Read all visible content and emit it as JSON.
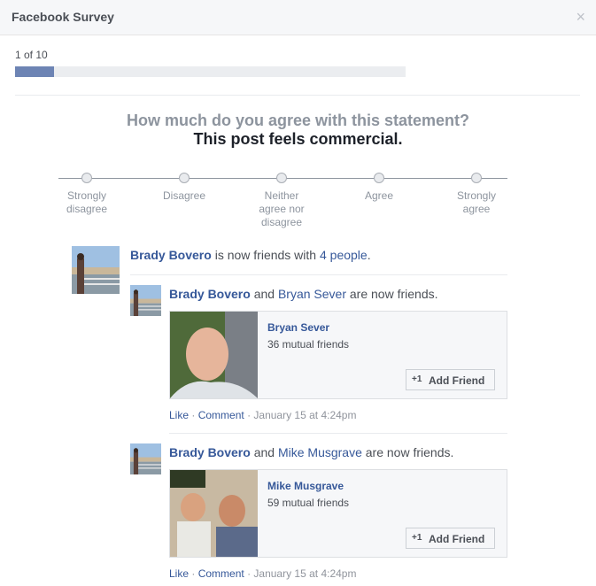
{
  "dialog": {
    "title": "Facebook Survey",
    "close_glyph": "×"
  },
  "progress": {
    "text": "1 of 10",
    "fraction": 0.1
  },
  "question": {
    "prompt": "How much do you agree with this statement?",
    "statement": "This post feels commercial."
  },
  "scale": {
    "options": [
      {
        "label": "Strongly disagree"
      },
      {
        "label": "Disagree"
      },
      {
        "label": "Neither agree nor disagree"
      },
      {
        "label": "Agree"
      },
      {
        "label": "Strongly agree"
      }
    ]
  },
  "story": {
    "actor": "Brady Bovero",
    "text": "is now friends with",
    "count_link": "4 people",
    "end": ".",
    "items": [
      {
        "actor": "Brady Bovero",
        "joiner": "and",
        "friend": "Bryan Sever",
        "tail": "are now friends.",
        "card": {
          "name": "Bryan Sever",
          "mutual": "36 mutual friends",
          "button": "Add Friend",
          "button_icon": "+1"
        },
        "actions": {
          "like": "Like",
          "dot1": "·",
          "comment": "Comment",
          "dot2": "·",
          "time": "January 15 at 4:24pm"
        }
      },
      {
        "actor": "Brady Bovero",
        "joiner": "and",
        "friend": "Mike Musgrave",
        "tail": "are now friends.",
        "card": {
          "name": "Mike Musgrave",
          "mutual": "59 mutual friends",
          "button": "Add Friend",
          "button_icon": "+1"
        },
        "actions": {
          "like": "Like",
          "dot1": "·",
          "comment": "Comment",
          "dot2": "·",
          "time": "January 15 at 4:24pm"
        }
      }
    ]
  },
  "colors": {
    "link": "#365899",
    "progress": "#6d84b4",
    "muted": "#8d949e"
  }
}
